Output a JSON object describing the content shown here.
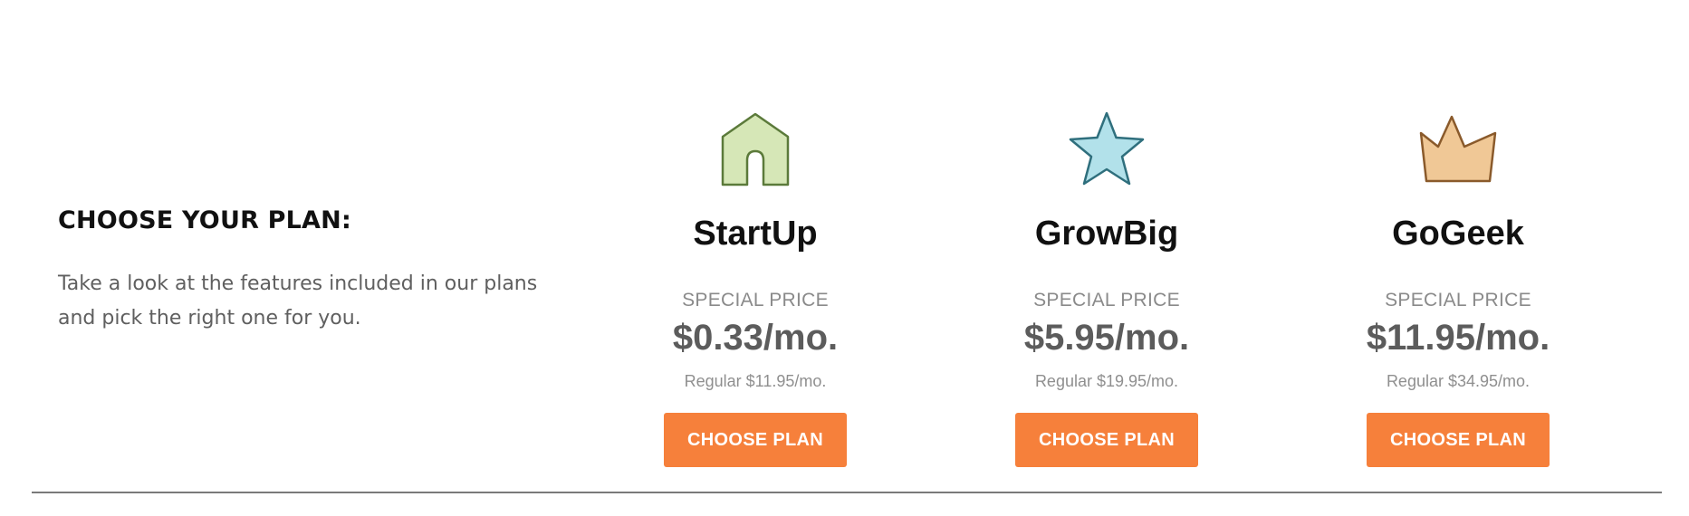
{
  "intro": {
    "title": "CHOOSE YOUR PLAN:",
    "description": "Take a look at the features included in our plans and pick the right one for you."
  },
  "plans": [
    {
      "name": "StartUp",
      "icon": "house-icon",
      "icon_fill": "#d6e7b7",
      "icon_stroke": "#5b7a3a",
      "special_label": "SPECIAL PRICE",
      "price": "$0.33/mo.",
      "regular": "Regular $11.95/mo.",
      "button_label": "CHOOSE PLAN"
    },
    {
      "name": "GrowBig",
      "icon": "star-icon",
      "icon_fill": "#b2e1ea",
      "icon_stroke": "#2f6f7d",
      "special_label": "SPECIAL PRICE",
      "price": "$5.95/mo.",
      "regular": "Regular $19.95/mo.",
      "button_label": "CHOOSE PLAN"
    },
    {
      "name": "GoGeek",
      "icon": "crown-icon",
      "icon_fill": "#f0c896",
      "icon_stroke": "#8a5a2b",
      "special_label": "SPECIAL PRICE",
      "price": "$11.95/mo.",
      "regular": "Regular $34.95/mo.",
      "button_label": "CHOOSE PLAN"
    }
  ],
  "colors": {
    "button": "#f6803b",
    "heading": "#111111",
    "price": "#5c5c5c",
    "muted": "#8a8a8a"
  }
}
